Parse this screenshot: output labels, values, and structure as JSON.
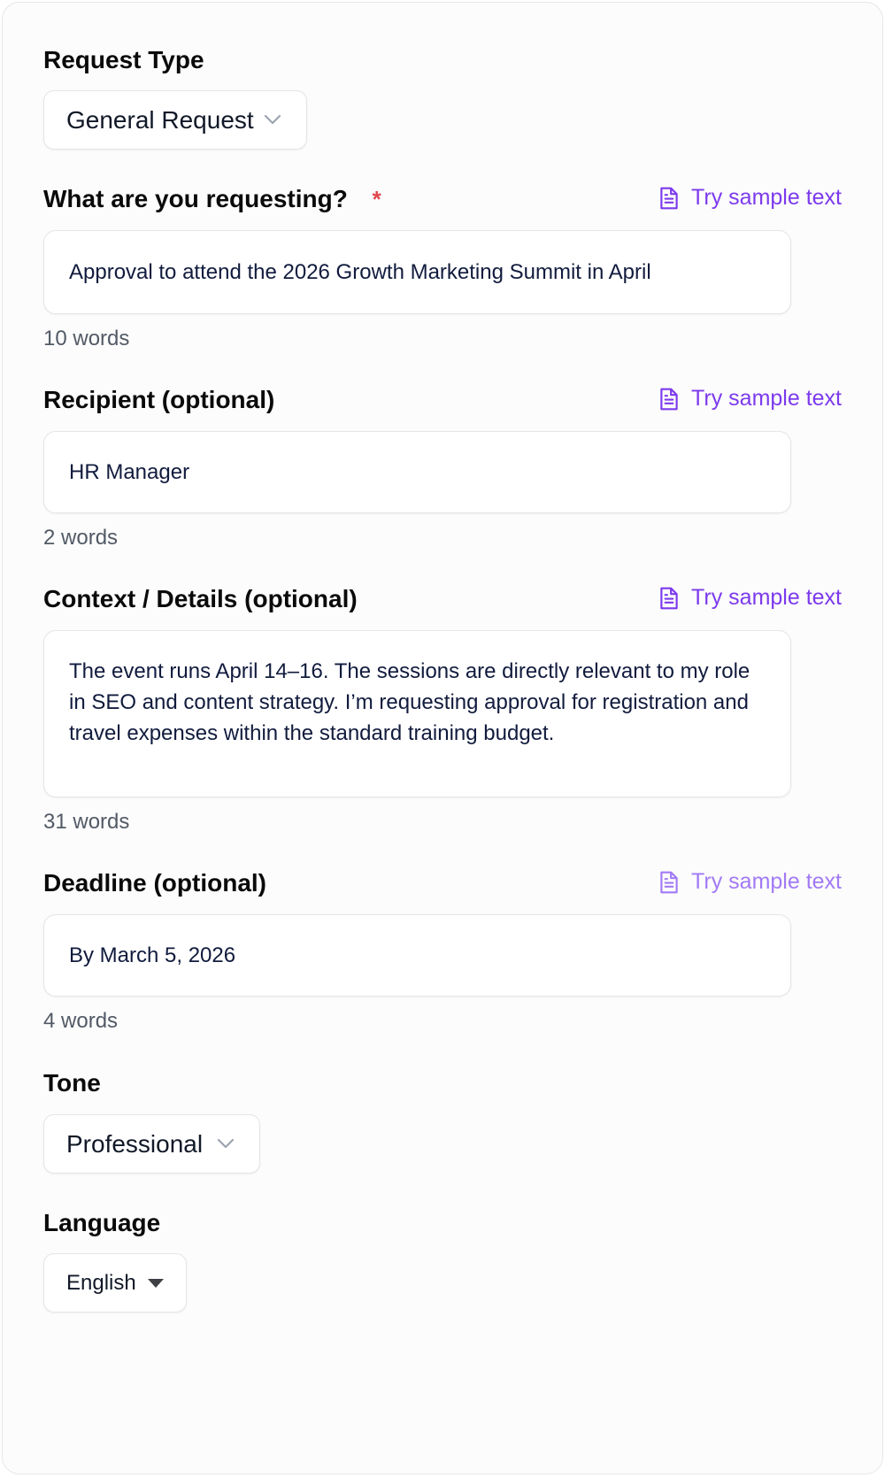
{
  "request_type": {
    "label": "Request Type",
    "value": "General Request"
  },
  "sample_link_label": "Try sample text",
  "what": {
    "label": "What are you requesting?",
    "required_mark": "*",
    "value": "Approval to attend the 2026 Growth Marketing Summit in April",
    "word_count": "10 words"
  },
  "recipient": {
    "label": "Recipient (optional)",
    "value": "HR Manager",
    "word_count": "2 words"
  },
  "context": {
    "label": "Context / Details (optional)",
    "value": "The event runs April 14–16. The sessions are directly relevant to my role in SEO and content strategy. I’m requesting approval for registration and travel expenses within the standard training budget.",
    "word_count": "31 words"
  },
  "deadline": {
    "label": "Deadline (optional)",
    "value": "By March 5, 2026",
    "word_count": "4 words"
  },
  "tone": {
    "label": "Tone",
    "value": "Professional"
  },
  "language": {
    "label": "Language",
    "value": "English"
  },
  "icons": {
    "sample": "document-icon",
    "dropdown": "chevron-down-icon",
    "native_select": "caret-down-icon"
  },
  "colors": {
    "accent": "#7c3aed",
    "accent_faded": "#a27af5",
    "required": "#e0484f",
    "border": "#e3e5e8",
    "muted_text": "#525a66"
  }
}
